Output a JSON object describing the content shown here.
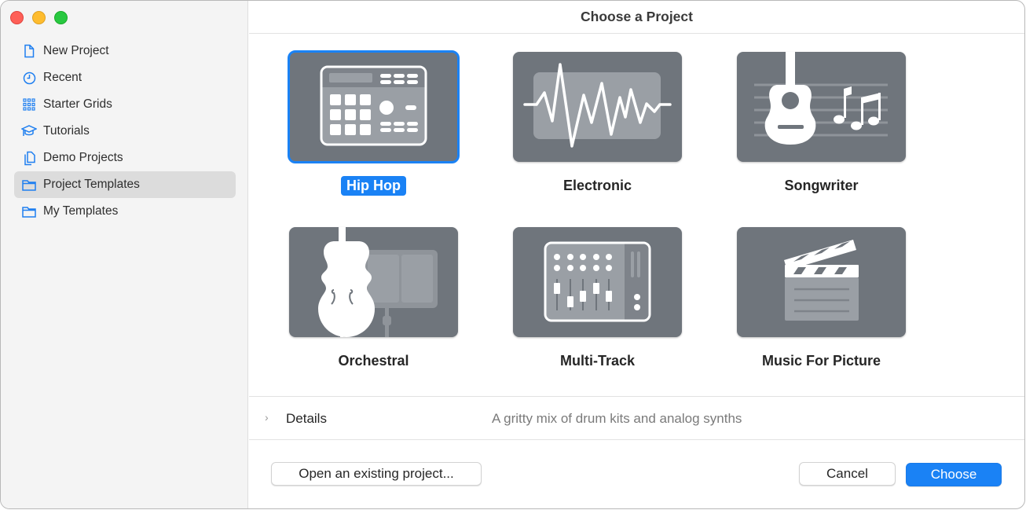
{
  "window": {
    "title": "Choose a Project",
    "controls": [
      "close",
      "minimize",
      "zoom"
    ]
  },
  "sidebar": {
    "items": [
      {
        "label": "New Project",
        "icon": "document-icon",
        "selected": false
      },
      {
        "label": "Recent",
        "icon": "clock-icon",
        "selected": false
      },
      {
        "label": "Starter Grids",
        "icon": "grid-icon",
        "selected": false
      },
      {
        "label": "Tutorials",
        "icon": "graduation-cap-icon",
        "selected": false
      },
      {
        "label": "Demo Projects",
        "icon": "documents-icon",
        "selected": false
      },
      {
        "label": "Project Templates",
        "icon": "folder-icon",
        "selected": true
      },
      {
        "label": "My Templates",
        "icon": "folder-icon",
        "selected": false
      }
    ]
  },
  "templates": [
    {
      "label": "Hip Hop",
      "icon": "drum-machine-icon",
      "selected": true
    },
    {
      "label": "Electronic",
      "icon": "waveform-icon",
      "selected": false
    },
    {
      "label": "Songwriter",
      "icon": "guitar-notes-icon",
      "selected": false
    },
    {
      "label": "Orchestral",
      "icon": "double-bass-icon",
      "selected": false
    },
    {
      "label": "Multi-Track",
      "icon": "mixer-icon",
      "selected": false
    },
    {
      "label": "Music For Picture",
      "icon": "clapperboard-icon",
      "selected": false
    }
  ],
  "details": {
    "label": "Details",
    "description": "A gritty mix of drum kits and analog synths"
  },
  "buttons": {
    "open_existing": "Open an existing project...",
    "cancel": "Cancel",
    "choose": "Choose"
  },
  "colors": {
    "accent": "#1a82f5",
    "thumb_bg": "#6f757c",
    "sidebar_bg": "#f4f4f4"
  }
}
